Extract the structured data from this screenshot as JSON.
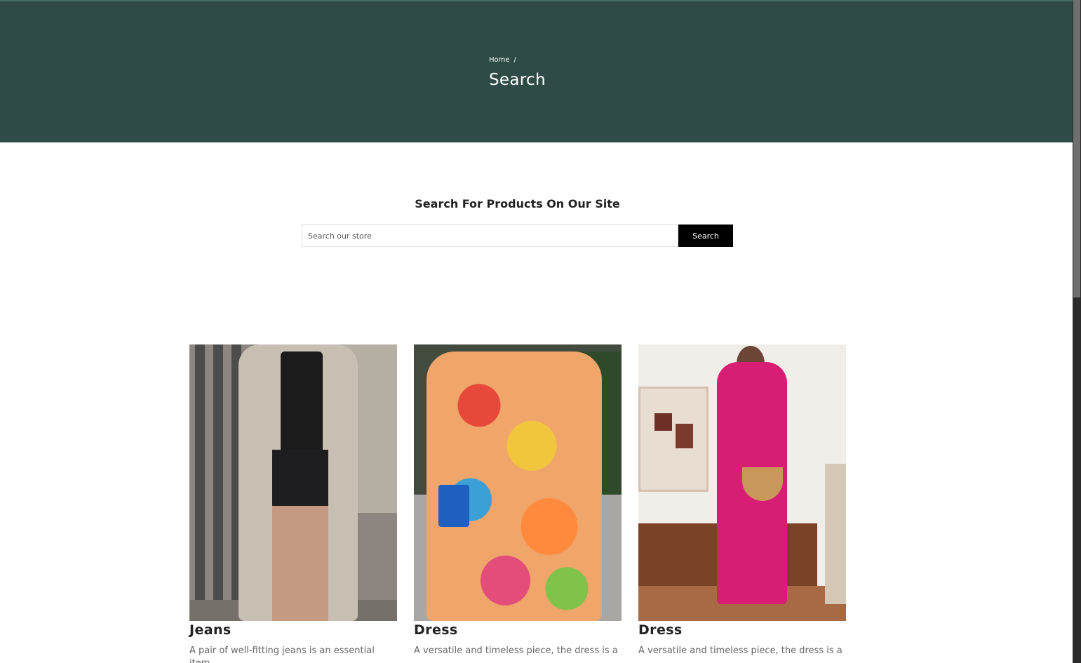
{
  "hero": {
    "breadcrumb": {
      "home": "Home",
      "separator": "/"
    },
    "title": "Search",
    "background": "#2e4b47"
  },
  "search": {
    "heading": "Search For Products On Our Site",
    "placeholder": "Search our store",
    "button_label": "Search"
  },
  "products": [
    {
      "title": "Jeans",
      "description": "A pair of well-fitting jeans is an essential item"
    },
    {
      "title": "Dress",
      "description": "A versatile and timeless piece, the dress is a"
    },
    {
      "title": "Dress",
      "description": "A versatile and timeless piece, the dress is a"
    }
  ]
}
